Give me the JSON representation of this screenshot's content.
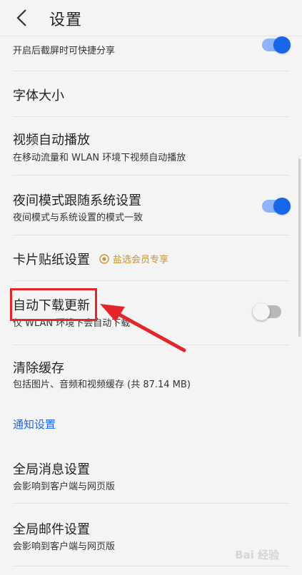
{
  "header": {
    "title": "设置"
  },
  "rows": [
    {
      "title": "",
      "subtitle": "开启后截屏时可快捷分享",
      "toggle": "on"
    },
    {
      "title": "字体大小",
      "subtitle": ""
    },
    {
      "title": "视频自动播放",
      "subtitle": "在移动流量和 WLAN 环境下视频自动播放"
    },
    {
      "title": "夜间模式跟随系统设置",
      "subtitle": "夜间模式与系统设置的模式一致",
      "toggle": "on"
    },
    {
      "title": "卡片贴纸设置",
      "subtitle": "",
      "badge": "盐选会员专享"
    },
    {
      "title": "自动下载更新",
      "subtitle": "仅 WLAN 环境下会自动下载",
      "toggle": "off"
    },
    {
      "title": "清除缓存",
      "subtitle": "包括图片、音频和视频缓存 (共 87.14 MB)"
    },
    {
      "title": "全局消息设置",
      "subtitle": "会影响到客户端与网页版"
    },
    {
      "title": "全局邮件设置",
      "subtitle": "会影响到客户端与网页版"
    }
  ],
  "section_notify": "通知设置",
  "watermark": "Bai 经验",
  "colors": {
    "accent": "#1a66e8",
    "highlight": "#e3262a",
    "vip": "#c99434"
  },
  "icons": {
    "back": "chevron-left-icon",
    "vip": "vip-badge-icon",
    "arrow": "red-arrow-annotation"
  }
}
